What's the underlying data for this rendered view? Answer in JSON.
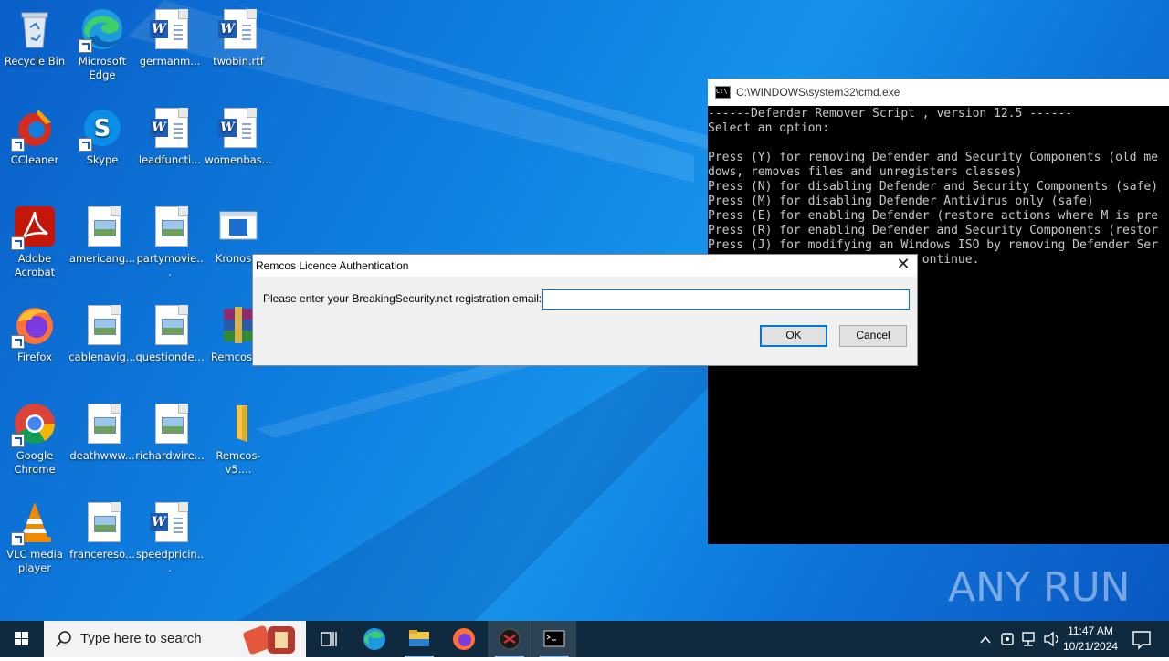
{
  "desktop": {
    "icons": [
      {
        "label": "Recycle Bin",
        "icon": "recycle-bin-icon"
      },
      {
        "label": "Microsoft Edge",
        "icon": "edge-icon"
      },
      {
        "label": "germanm...",
        "icon": "word-doc-icon"
      },
      {
        "label": "twobin.rtf",
        "icon": "word-doc-icon"
      },
      {
        "label": "CCleaner",
        "icon": "ccleaner-icon"
      },
      {
        "label": "Skype",
        "icon": "skype-icon"
      },
      {
        "label": "leadfuncti...",
        "icon": "word-doc-icon"
      },
      {
        "label": "womenbas...",
        "icon": "word-doc-icon"
      },
      {
        "label": "Adobe Acrobat",
        "icon": "acrobat-icon"
      },
      {
        "label": "americang...",
        "icon": "image-file-icon"
      },
      {
        "label": "partymovie...",
        "icon": "image-file-icon"
      },
      {
        "label": "Kronos...",
        "icon": "app-window-icon"
      },
      {
        "label": "Firefox",
        "icon": "firefox-icon"
      },
      {
        "label": "cablenavig...",
        "icon": "image-file-icon"
      },
      {
        "label": "questionde...",
        "icon": "image-file-icon"
      },
      {
        "label": "Remcos-...",
        "icon": "winrar-archive-icon"
      },
      {
        "label": "Google Chrome",
        "icon": "chrome-icon"
      },
      {
        "label": "deathwww...",
        "icon": "image-file-icon"
      },
      {
        "label": "richardwire...",
        "icon": "image-file-icon"
      },
      {
        "label": "Remcos-v5....",
        "icon": "folder-icon"
      },
      {
        "label": "VLC media player",
        "icon": "vlc-icon"
      },
      {
        "label": "francereso...",
        "icon": "image-file-icon"
      },
      {
        "label": "speedpricin...",
        "icon": "word-doc-icon"
      }
    ]
  },
  "cmd": {
    "title": "C:\\WINDOWS\\system32\\cmd.exe",
    "lines": [
      "------Defender Remover Script , version 12.5 ------",
      "Select an option:",
      "",
      "Press (Y) for removing Defender and Security Components (old me",
      "dows, removes files and unregisters classes)",
      "Press (N) for disabling Defender and Security Components (safe)",
      "Press (M) for disabling Defender Antivirus only (safe)",
      "Press (E) for enabling Defender (restore actions where M is pre",
      "Press (R) for enabling Defender and Security Components (restor",
      "Press (J) for modifying an Windows ISO by removing Defender Ser",
      "                              ontinue."
    ]
  },
  "dialog": {
    "title": "Remcos Licence Authentication",
    "prompt": "Please enter your BreakingSecurity.net registration email:",
    "email_value": "",
    "ok_label": "OK",
    "cancel_label": "Cancel"
  },
  "watermark": {
    "text": "ANY RUN"
  },
  "taskbar": {
    "search_placeholder": "Type here to search",
    "time": "11:47 AM",
    "date": "10/21/2024"
  },
  "colors": {
    "desktop_blue": "#0f7fe0",
    "taskbar": "#0f2a3f",
    "dialog_bg": "#f0f0f0",
    "focus_blue": "#0078d7"
  }
}
